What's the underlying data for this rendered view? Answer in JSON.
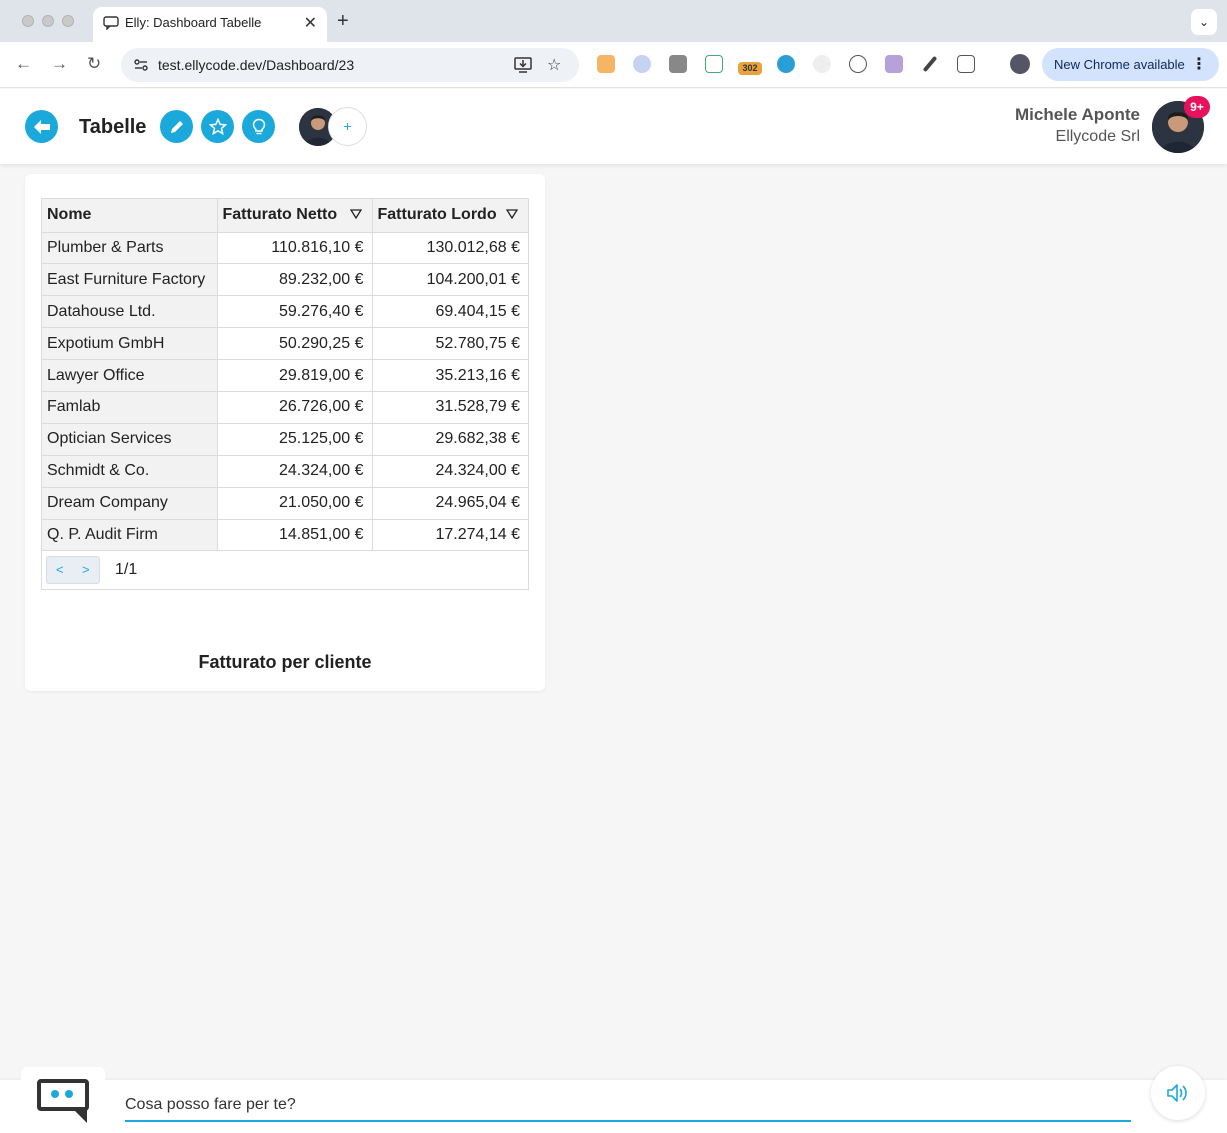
{
  "browser": {
    "tab_title": "Elly: Dashboard Tabelle",
    "url": "test.ellycode.dev/Dashboard/23",
    "update_label": "New Chrome available",
    "extension_badge": "302"
  },
  "header": {
    "title": "Tabelle",
    "user_name": "Michele Aponte",
    "user_company": "Ellycode Srl",
    "notification_badge": "9+",
    "accent_color": "#1ba9dc"
  },
  "table": {
    "columns": [
      "Nome",
      "Fatturato Netto",
      "Fatturato Lordo"
    ],
    "rows": [
      {
        "nome": "Plumber & Parts",
        "netto": "110.816,10 €",
        "lordo": "130.012,68 €"
      },
      {
        "nome": "East Furniture Factory",
        "netto": "89.232,00 €",
        "lordo": "104.200,01 €"
      },
      {
        "nome": "Datahouse Ltd.",
        "netto": "59.276,40 €",
        "lordo": "69.404,15 €"
      },
      {
        "nome": "Expotium GmbH",
        "netto": "50.290,25 €",
        "lordo": "52.780,75 €"
      },
      {
        "nome": "Lawyer Office",
        "netto": "29.819,00 €",
        "lordo": "35.213,16 €"
      },
      {
        "nome": "Famlab",
        "netto": "26.726,00 €",
        "lordo": "31.528,79 €"
      },
      {
        "nome": "Optician Services",
        "netto": "25.125,00 €",
        "lordo": "29.682,38 €"
      },
      {
        "nome": "Schmidt & Co.",
        "netto": "24.324,00 €",
        "lordo": "24.324,00 €"
      },
      {
        "nome": "Dream Company",
        "netto": "21.050,00 €",
        "lordo": "24.965,04 €"
      },
      {
        "nome": "Q. P. Audit Firm",
        "netto": "14.851,00 €",
        "lordo": "17.274,14 €"
      }
    ],
    "pager": {
      "prev": "<",
      "next": ">",
      "page": "1/1"
    },
    "title": "Fatturato per cliente"
  },
  "chat": {
    "placeholder": "Cosa posso fare per te?"
  }
}
